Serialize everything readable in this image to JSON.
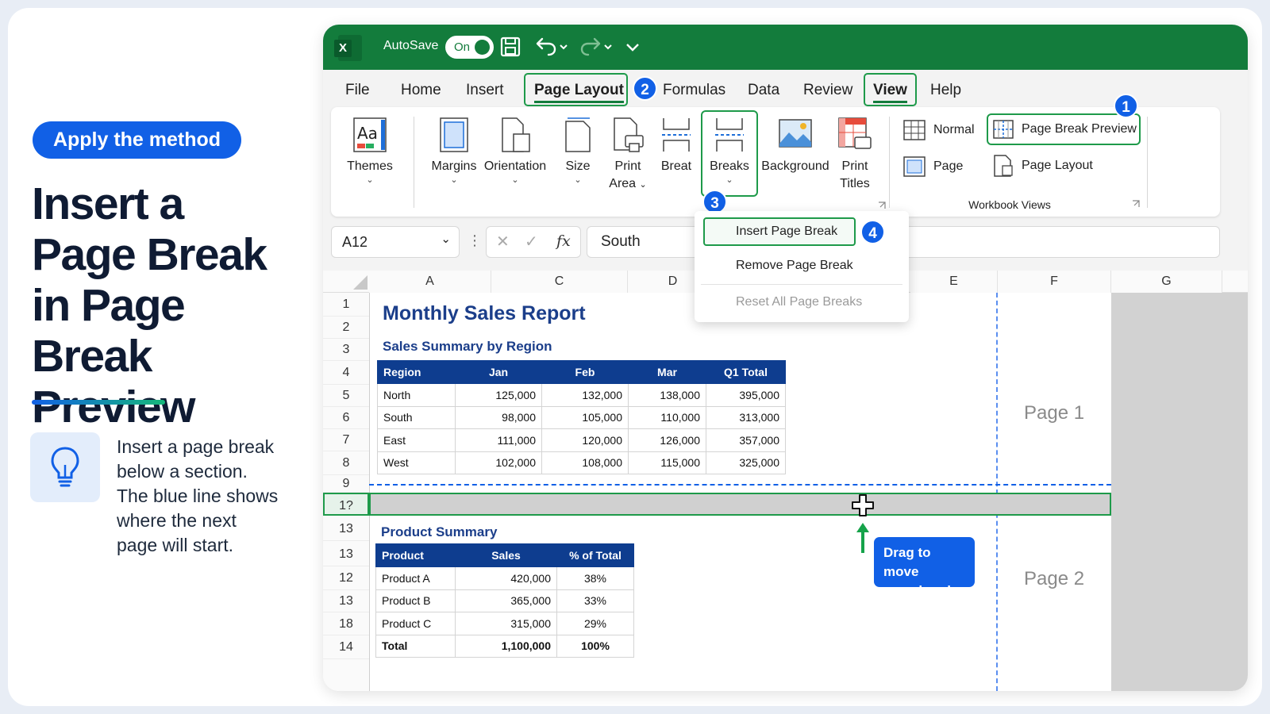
{
  "left": {
    "badge": "Apply the method",
    "headline_1": "Insert a",
    "headline_2": "Page Break",
    "headline_3": "in Page Break",
    "headline_4": "Preview",
    "tip_1": "Insert a page break",
    "tip_2": "below a section.",
    "tip_3": "The blue line shows",
    "tip_4": "where the next",
    "tip_5": "page will start."
  },
  "titlebar": {
    "logo": "X",
    "autosave": "AutoSave",
    "toggle": "On"
  },
  "tabs": [
    "File",
    "Home",
    "Insert",
    "Page Layout",
    "Formulas",
    "Data",
    "Review",
    "View",
    "Help"
  ],
  "ribbon": {
    "themes": "Themes",
    "margins": "Margins",
    "orientation": "Orientation",
    "size": "Size",
    "print_area_1": "Print",
    "print_area_2": "Area",
    "breat": "Breat",
    "breaks": "Breaks",
    "background": "Background",
    "print_titles_1": "Print",
    "print_titles_2": "Titles",
    "normal": "Normal",
    "page_break_preview": "Page Break Preview",
    "page": "Page",
    "page_layout": "Page Layout",
    "workbook_views": "Workbook Views"
  },
  "steps": [
    "1",
    "2",
    "3",
    "4"
  ],
  "formula": {
    "namebox": "A12",
    "fx": "fx",
    "value": "South"
  },
  "breaks_menu": {
    "insert": "Insert Page Break",
    "remove": "Remove Page Break",
    "reset": "Reset All Page Breaks"
  },
  "columns": [
    "A",
    "C",
    "D",
    "E",
    "F",
    "G"
  ],
  "rows": [
    "1",
    "2",
    "3",
    "4",
    "5",
    "6",
    "7",
    "8",
    "9",
    "1?",
    "13",
    "13",
    "12",
    "13",
    "18",
    "14"
  ],
  "sheet": {
    "title": "Monthly Sales Report",
    "region_title": "Sales Summary by Region",
    "region_headers": [
      "Region",
      "Jan",
      "Feb",
      "Mar",
      "Q1 Total"
    ],
    "region_rows": [
      [
        "North",
        "125,000",
        "132,000",
        "138,000",
        "395,000"
      ],
      [
        "South",
        "98,000",
        "105,000",
        "110,000",
        "313,000"
      ],
      [
        "East",
        "111,000",
        "120,000",
        "126,000",
        "357,000"
      ],
      [
        "West",
        "102,000",
        "108,000",
        "115,000",
        "325,000"
      ]
    ],
    "product_title": "Product Summary",
    "product_headers": [
      "Product",
      "Sales",
      "% of Total"
    ],
    "product_rows": [
      [
        "Product A",
        "420,000",
        "38%"
      ],
      [
        "Product B",
        "365,000",
        "33%"
      ],
      [
        "Product C",
        "315,000",
        "29%"
      ],
      [
        "Total",
        "1,100,000",
        "100%"
      ]
    ],
    "page1": "Page 1",
    "page2": "Page 2",
    "callout_1": "Drag to move",
    "callout_2": "page break"
  },
  "colors": {
    "excel_green": "#137c3c",
    "accent_blue": "#1160e6",
    "table_header": "#0e3d8f",
    "highlight_green": "#1e9a4a"
  }
}
